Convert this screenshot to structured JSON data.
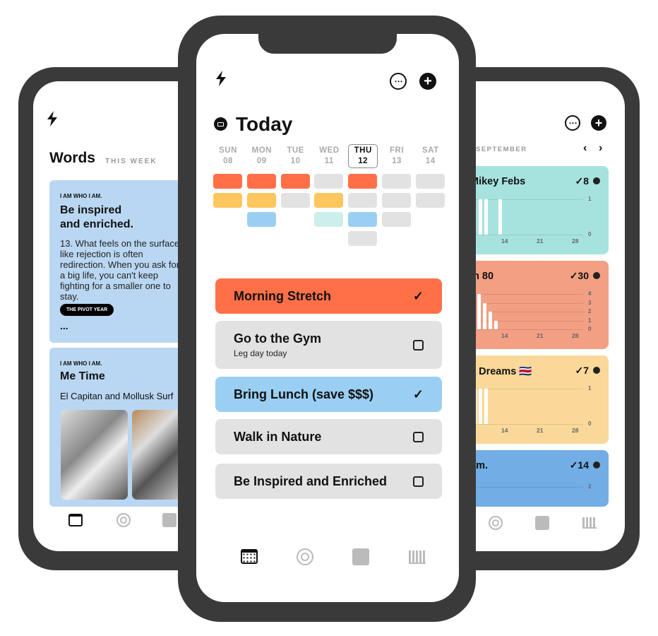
{
  "left": {
    "title": "Words",
    "subtitle": "THIS WEEK",
    "cards": [
      {
        "eyebrow": "I AM WHO I AM.",
        "title": "Be inspired and enriched.",
        "body": "13. What feels on the surface like rejection is often redirection. When you ask for a big life, you can't keep fighting for a smaller one to stay.",
        "tag": "THE PIVOT YEAR",
        "more": "..."
      },
      {
        "eyebrow": "I AM WHO I AM.",
        "title": "Me Time",
        "body": "El Capitan and Mollusk Surf"
      }
    ],
    "color": "#b9d7f2"
  },
  "center": {
    "title": "Today",
    "days": [
      {
        "d": "SUN",
        "n": "08"
      },
      {
        "d": "MON",
        "n": "09"
      },
      {
        "d": "TUE",
        "n": "10"
      },
      {
        "d": "WED",
        "n": "11"
      },
      {
        "d": "THU",
        "n": "12",
        "selected": true
      },
      {
        "d": "FRI",
        "n": "13"
      },
      {
        "d": "SAT",
        "n": "14"
      }
    ],
    "grid": [
      [
        "#ff7049",
        "#ffc55e",
        null,
        null
      ],
      [
        "#ff7049",
        "#ffc55e",
        "#9acff3",
        null
      ],
      [
        "#ff7049",
        "#e2e2e2",
        null,
        null
      ],
      [
        "#e2e2e2",
        "#ffc55e",
        "#cdefeb",
        null
      ],
      [
        "#ff7049",
        "#e2e2e2",
        "#9acff3",
        "#e2e2e2"
      ],
      [
        "#e2e2e2",
        "#e2e2e2",
        "#e2e2e2",
        null
      ],
      [
        "#e2e2e2",
        "#e2e2e2",
        null,
        null
      ]
    ],
    "tasks": [
      {
        "title": "Morning Stretch",
        "done": true,
        "color": "#ff7049"
      },
      {
        "title": "Go to the Gym",
        "sub": "Leg day today",
        "done": false,
        "color": "#e2e2e2"
      },
      {
        "title": "Bring Lunch (save $$$)",
        "done": true,
        "color": "#9acff3"
      },
      {
        "title": "Walk in Nature",
        "done": false,
        "color": "#e2e2e2"
      },
      {
        "title": "Be Inspired and Enriched",
        "done": false,
        "color": "#e2e2e2"
      }
    ]
  },
  "right": {
    "month": "SEPTEMBER",
    "cards": [
      {
        "name": "Mikey Febs",
        "count": "✓8",
        "color": "#a6e3df",
        "yticks": [
          "1",
          "0"
        ],
        "xticks": [
          "14",
          "21",
          "28"
        ],
        "bars": [
          1,
          1,
          1
        ]
      },
      {
        "name": "m 80",
        "count": "✓30",
        "color": "#f29f84",
        "yticks": [
          "4",
          "3",
          "2",
          "1",
          "0"
        ],
        "xticks": [
          "14",
          "21",
          "28"
        ],
        "bars": [
          3,
          4,
          3,
          2,
          1
        ]
      },
      {
        "name": "a Dreams 🇨🇷",
        "count": "✓7",
        "color": "#fad899",
        "yticks": [
          "1",
          "0"
        ],
        "xticks": [
          "14",
          "21",
          "28"
        ],
        "bars": [
          1,
          1,
          1
        ]
      },
      {
        "name": "am.",
        "count": "✓14",
        "color": "#72ade6",
        "yticks": [
          "2"
        ]
      }
    ]
  },
  "icons": {
    "more": "⋯",
    "add": "+",
    "check": "✓",
    "bolt": "⚡"
  }
}
